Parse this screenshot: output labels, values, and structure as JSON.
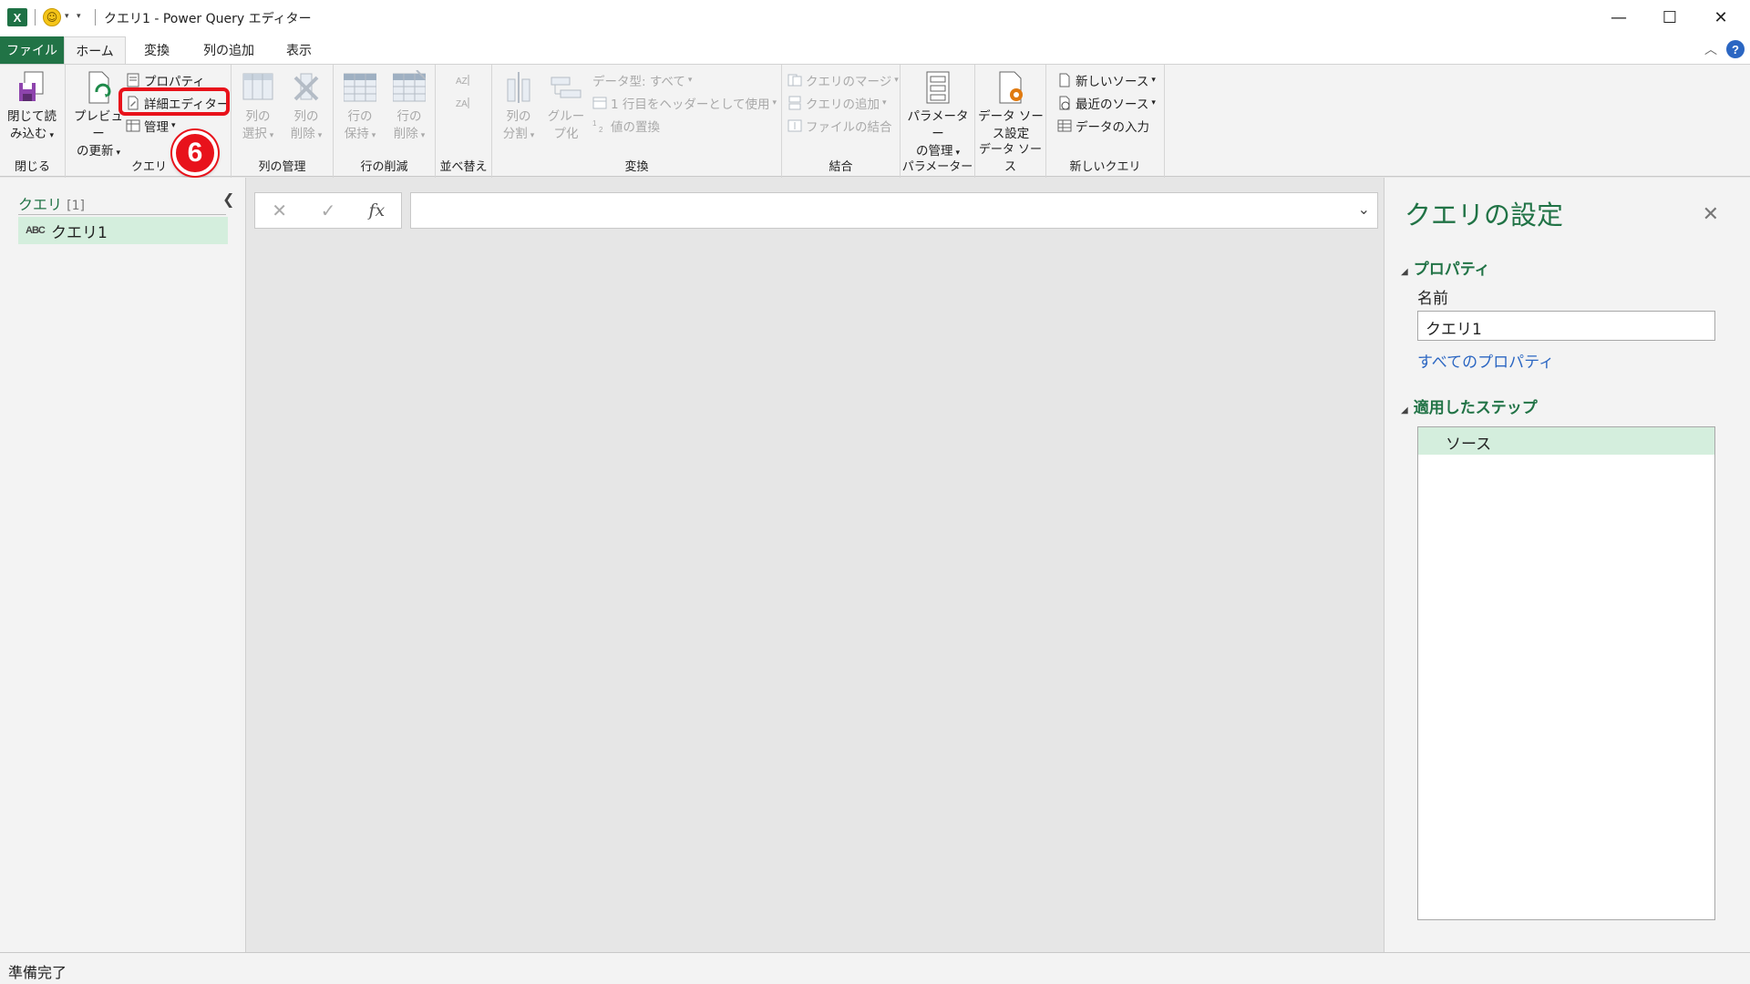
{
  "app": {
    "title": "クエリ1 - Power Query エディター",
    "excel_badge": "X",
    "colors": {
      "brand_green": "#217346",
      "accent_red": "#e8121b",
      "link_blue": "#2b66c2",
      "selection_green": "#d4eedd"
    }
  },
  "ribbon_tabs": [
    "ファイル",
    "ホーム",
    "変換",
    "列の追加",
    "表示"
  ],
  "ribbon": {
    "close_group": {
      "button": [
        "閉じて読",
        "み込む"
      ],
      "label": "閉じる"
    },
    "query_group": {
      "preview": [
        "プレビュー",
        "の更新"
      ],
      "properties": "プロパティ",
      "advanced_editor": "詳細エディター",
      "manage": "管理",
      "label": "クエリ"
    },
    "columns_group": {
      "choose": [
        "列の",
        "選択"
      ],
      "remove": [
        "列の",
        "削除"
      ],
      "label": "列の管理"
    },
    "rows_group": {
      "keep": [
        "行の",
        "保持"
      ],
      "remove": [
        "行の",
        "削除"
      ],
      "label": "行の削減"
    },
    "sort_group": {
      "label": "並べ替え"
    },
    "transform_group": {
      "split": [
        "列の",
        "分割"
      ],
      "group": [
        "グルー",
        "プ化"
      ],
      "data_type": "データ型: すべて",
      "header": "1 行目をヘッダーとして使用",
      "replace": "値の置換",
      "label": "変換"
    },
    "combine_group": {
      "merge": "クエリのマージ",
      "append": "クエリの追加",
      "files": "ファイルの結合",
      "label": "結合"
    },
    "params_group": {
      "button": [
        "パラメーター",
        "の管理"
      ],
      "label": "パラメーター"
    },
    "datasource_group": {
      "button": [
        "データ ソー",
        "ス設定"
      ],
      "label": "データ ソース"
    },
    "newquery_group": {
      "new_source": "新しいソース",
      "recent": "最近のソース",
      "enter_data": "データの入力",
      "label": "新しいクエリ"
    }
  },
  "annotation": {
    "step_number": "6"
  },
  "queries_pane": {
    "header": "クエリ",
    "count": "[1]",
    "type_icon": "ABC",
    "items": [
      "クエリ1"
    ]
  },
  "formula_bar": {
    "cancel": "✕",
    "commit": "✓",
    "fx": "fx",
    "value": ""
  },
  "settings_pane": {
    "title": "クエリの設定",
    "properties_header": "プロパティ",
    "name_label": "名前",
    "name_value": "クエリ1",
    "all_properties_link": "すべてのプロパティ",
    "steps_header": "適用したステップ",
    "steps": [
      "ソース"
    ]
  },
  "status": "準備完了"
}
